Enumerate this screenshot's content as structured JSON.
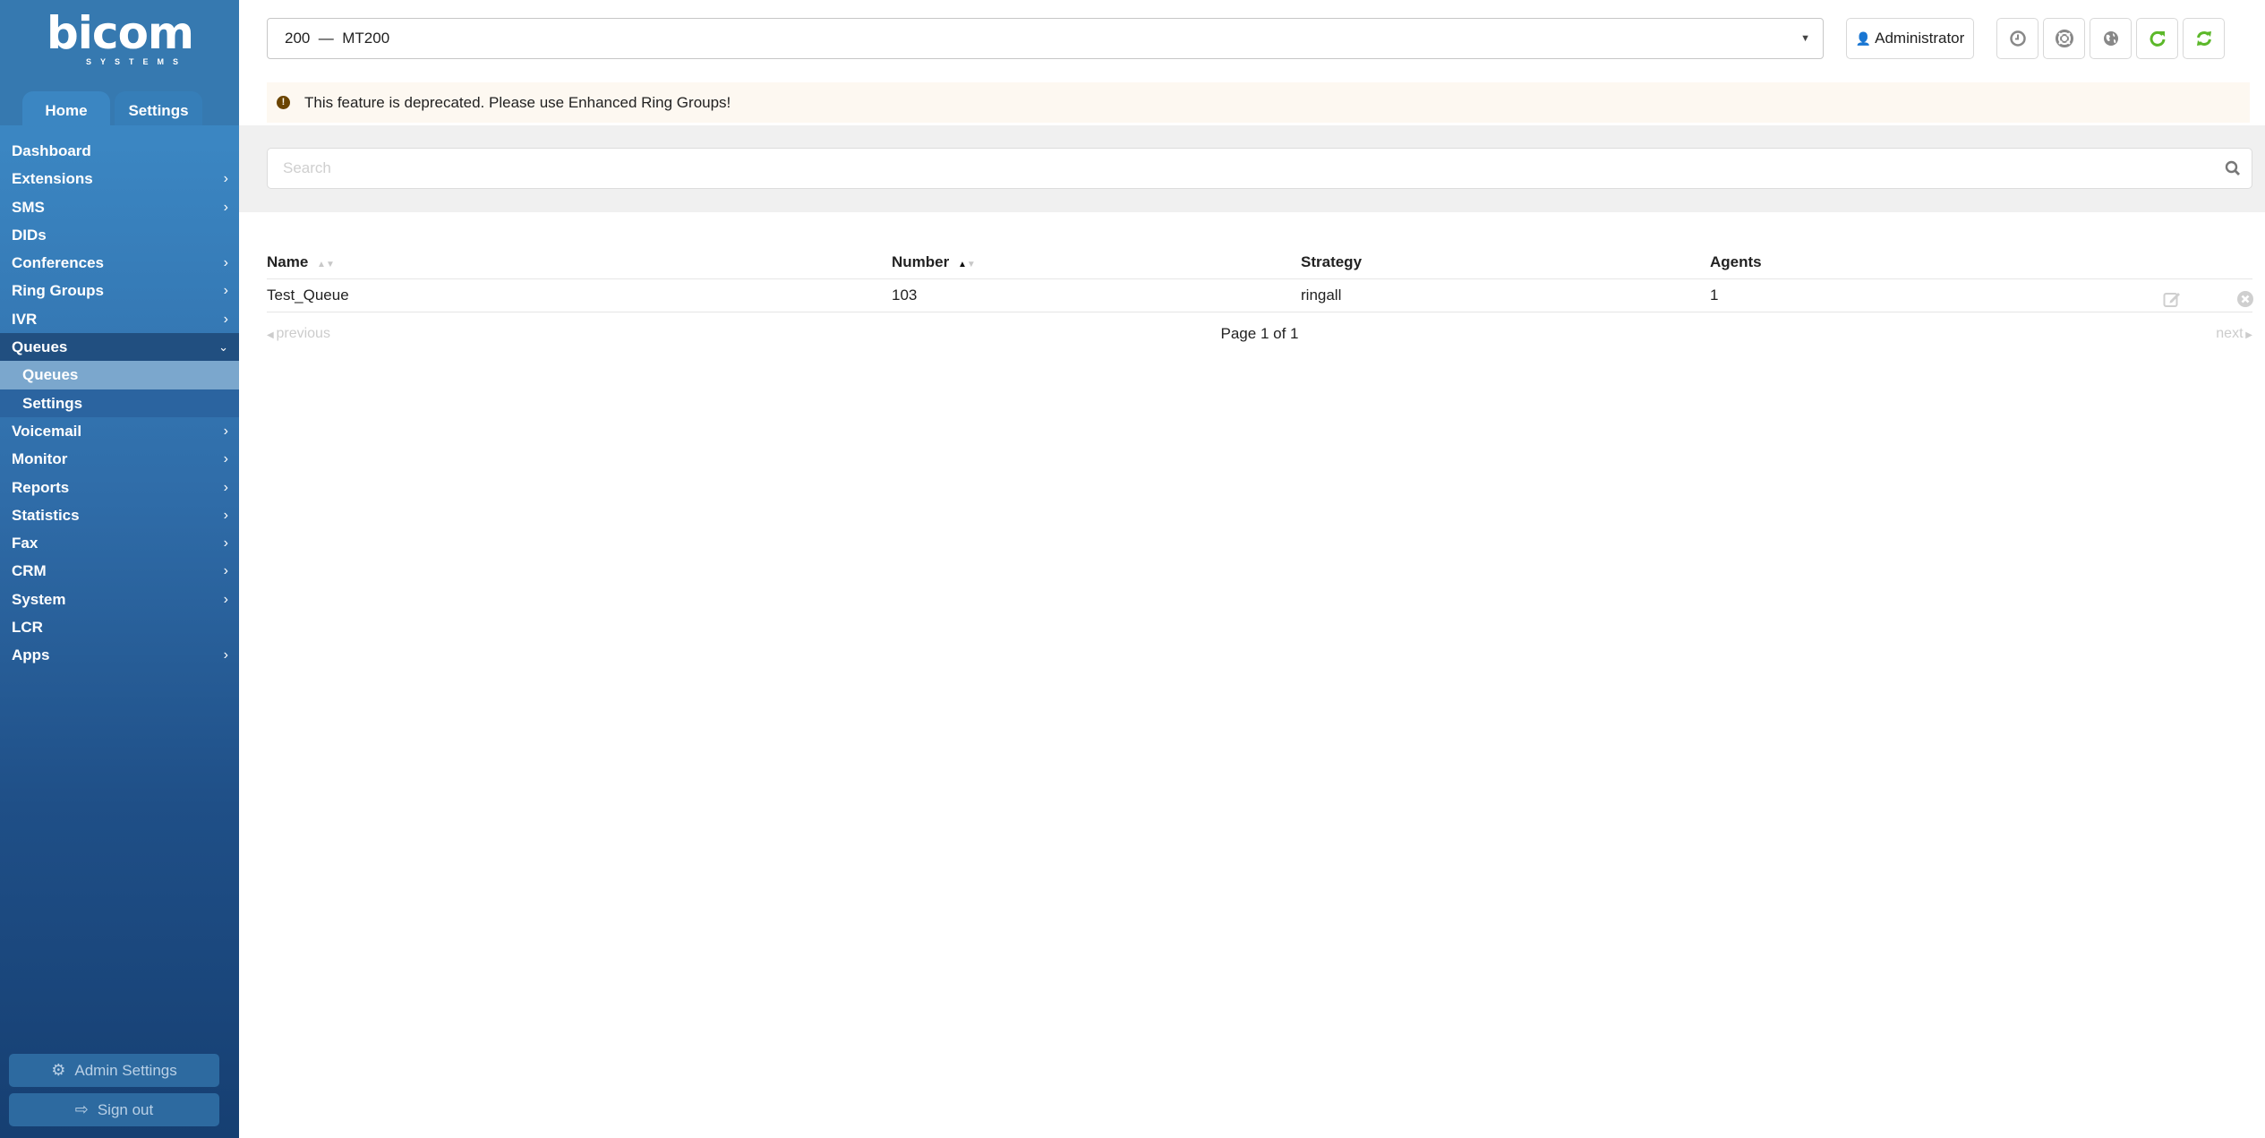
{
  "brand": {
    "name": "bicom",
    "tagline": "SYSTEMS"
  },
  "sidebar": {
    "tabs": [
      {
        "label": "Home",
        "active": true
      },
      {
        "label": "Settings",
        "active": false
      }
    ],
    "items": [
      {
        "label": "Dashboard",
        "has_children": false
      },
      {
        "label": "Extensions",
        "has_children": true
      },
      {
        "label": "SMS",
        "has_children": true
      },
      {
        "label": "DIDs",
        "has_children": false
      },
      {
        "label": "Conferences",
        "has_children": true
      },
      {
        "label": "Ring Groups",
        "has_children": true
      },
      {
        "label": "IVR",
        "has_children": true
      },
      {
        "label": "Queues",
        "has_children": true,
        "expanded": true
      },
      {
        "label": "Voicemail",
        "has_children": true
      },
      {
        "label": "Monitor",
        "has_children": true
      },
      {
        "label": "Reports",
        "has_children": true
      },
      {
        "label": "Statistics",
        "has_children": true
      },
      {
        "label": "Fax",
        "has_children": true
      },
      {
        "label": "CRM",
        "has_children": true
      },
      {
        "label": "System",
        "has_children": true
      },
      {
        "label": "LCR",
        "has_children": false
      },
      {
        "label": "Apps",
        "has_children": true
      }
    ],
    "queues_subitems": [
      {
        "label": "Queues",
        "selected": true
      },
      {
        "label": "Settings",
        "selected": false
      }
    ],
    "admin_settings_label": "Admin Settings",
    "sign_out_label": "Sign out"
  },
  "header": {
    "tenant_select_value": "200  —  MT200",
    "user_label": "Administrator",
    "icon_buttons": [
      "clock-icon",
      "lifebuoy-icon",
      "globe-icon",
      "reload-icon",
      "sync-icon"
    ],
    "accent_green": "#5cb82a"
  },
  "alert": {
    "message": "This feature is deprecated. Please use Enhanced Ring Groups!"
  },
  "search": {
    "placeholder": "Search",
    "value": ""
  },
  "table": {
    "columns": [
      {
        "label": "Name",
        "sortable": true,
        "sort": "none"
      },
      {
        "label": "Number",
        "sortable": true,
        "sort": "asc"
      },
      {
        "label": "Strategy",
        "sortable": false
      },
      {
        "label": "Agents",
        "sortable": false
      }
    ],
    "rows": [
      {
        "name": "Test_Queue",
        "number": "103",
        "strategy": "ringall",
        "agents": "1"
      }
    ]
  },
  "pagination": {
    "prev_label": "previous",
    "next_label": "next",
    "info": "Page 1 of 1"
  }
}
